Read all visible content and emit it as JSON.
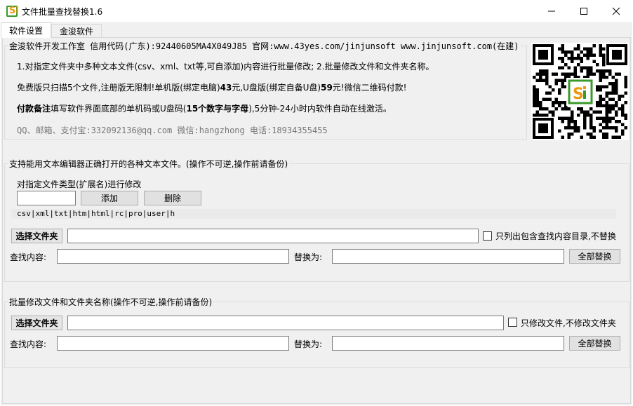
{
  "window": {
    "title": "文件批量查找替换1.6",
    "icon_name": "app-logo-icon",
    "icon_letters": "Si"
  },
  "tabs": [
    {
      "label": "软件设置",
      "active": true
    },
    {
      "label": "金浚软件",
      "active": false
    }
  ],
  "info": {
    "legend": "金浚软件开发工作室 信用代码(广东):92440605MA4X049J85 官网:www.43yes.com/jinjunsoft  www.jinjunsoft.com(在建)",
    "line1": "1.对指定文件夹中多种文本文件(csv、xml、txt等,可自添加)内容进行批量修改; 2.批量修改文件和文件夹名称。",
    "line2_a": "免费版只扫描5个文件,注册版无限制!单机版(绑定电脑)",
    "line2_b": "43",
    "line2_c": "元,U盘版(绑定自备U盘)",
    "line2_d": "59",
    "line2_e": "元!微信二维码付款!",
    "line3_a": "付款备注",
    "line3_b": "填写软件界面底部的单机码或U盘码(",
    "line3_c": "15个数字与字母",
    "line3_d": "),5分钟-24小时内软件自动在线激活。",
    "contact": "QQ、邮箱、支付宝:332092136@qq.com    微信:hangzhong    电话:18934355455"
  },
  "content_group": {
    "legend": "支持能用文本编辑器正确打开的各种文本文件。(操作不可逆,操作前请备份)",
    "ext_label": "对指定文件类型(扩展名)进行修改",
    "ext_input_value": "",
    "add_button": "添加",
    "delete_button": "删除",
    "ext_list": "csv|xml|txt|htm|html|rc|pro|user|h",
    "choose_folder_button": "选择文件夹",
    "folder_path": "",
    "only_list_checkbox_label": "只列出包含查找内容目录,不替换",
    "only_list_checked": false,
    "find_label": "查找内容:",
    "find_value": "",
    "replace_label": "替换为:",
    "replace_value": "",
    "replace_all_button": "全部替换"
  },
  "rename_group": {
    "legend": "批量修改文件和文件夹名称(操作不可逆,操作前请备份)",
    "choose_folder_button": "选择文件夹",
    "folder_path": "",
    "only_files_checkbox_label": "只修改文件,不修改文件夹",
    "only_files_checked": false,
    "find_label": "查找内容:",
    "find_value": "",
    "replace_label": "替换为:",
    "replace_value": "",
    "replace_all_button": "全部替换"
  },
  "colors": {
    "panel_bg": "#f0f0f0",
    "logo_green": "#3a9a2b",
    "logo_orange": "#e89a13"
  }
}
